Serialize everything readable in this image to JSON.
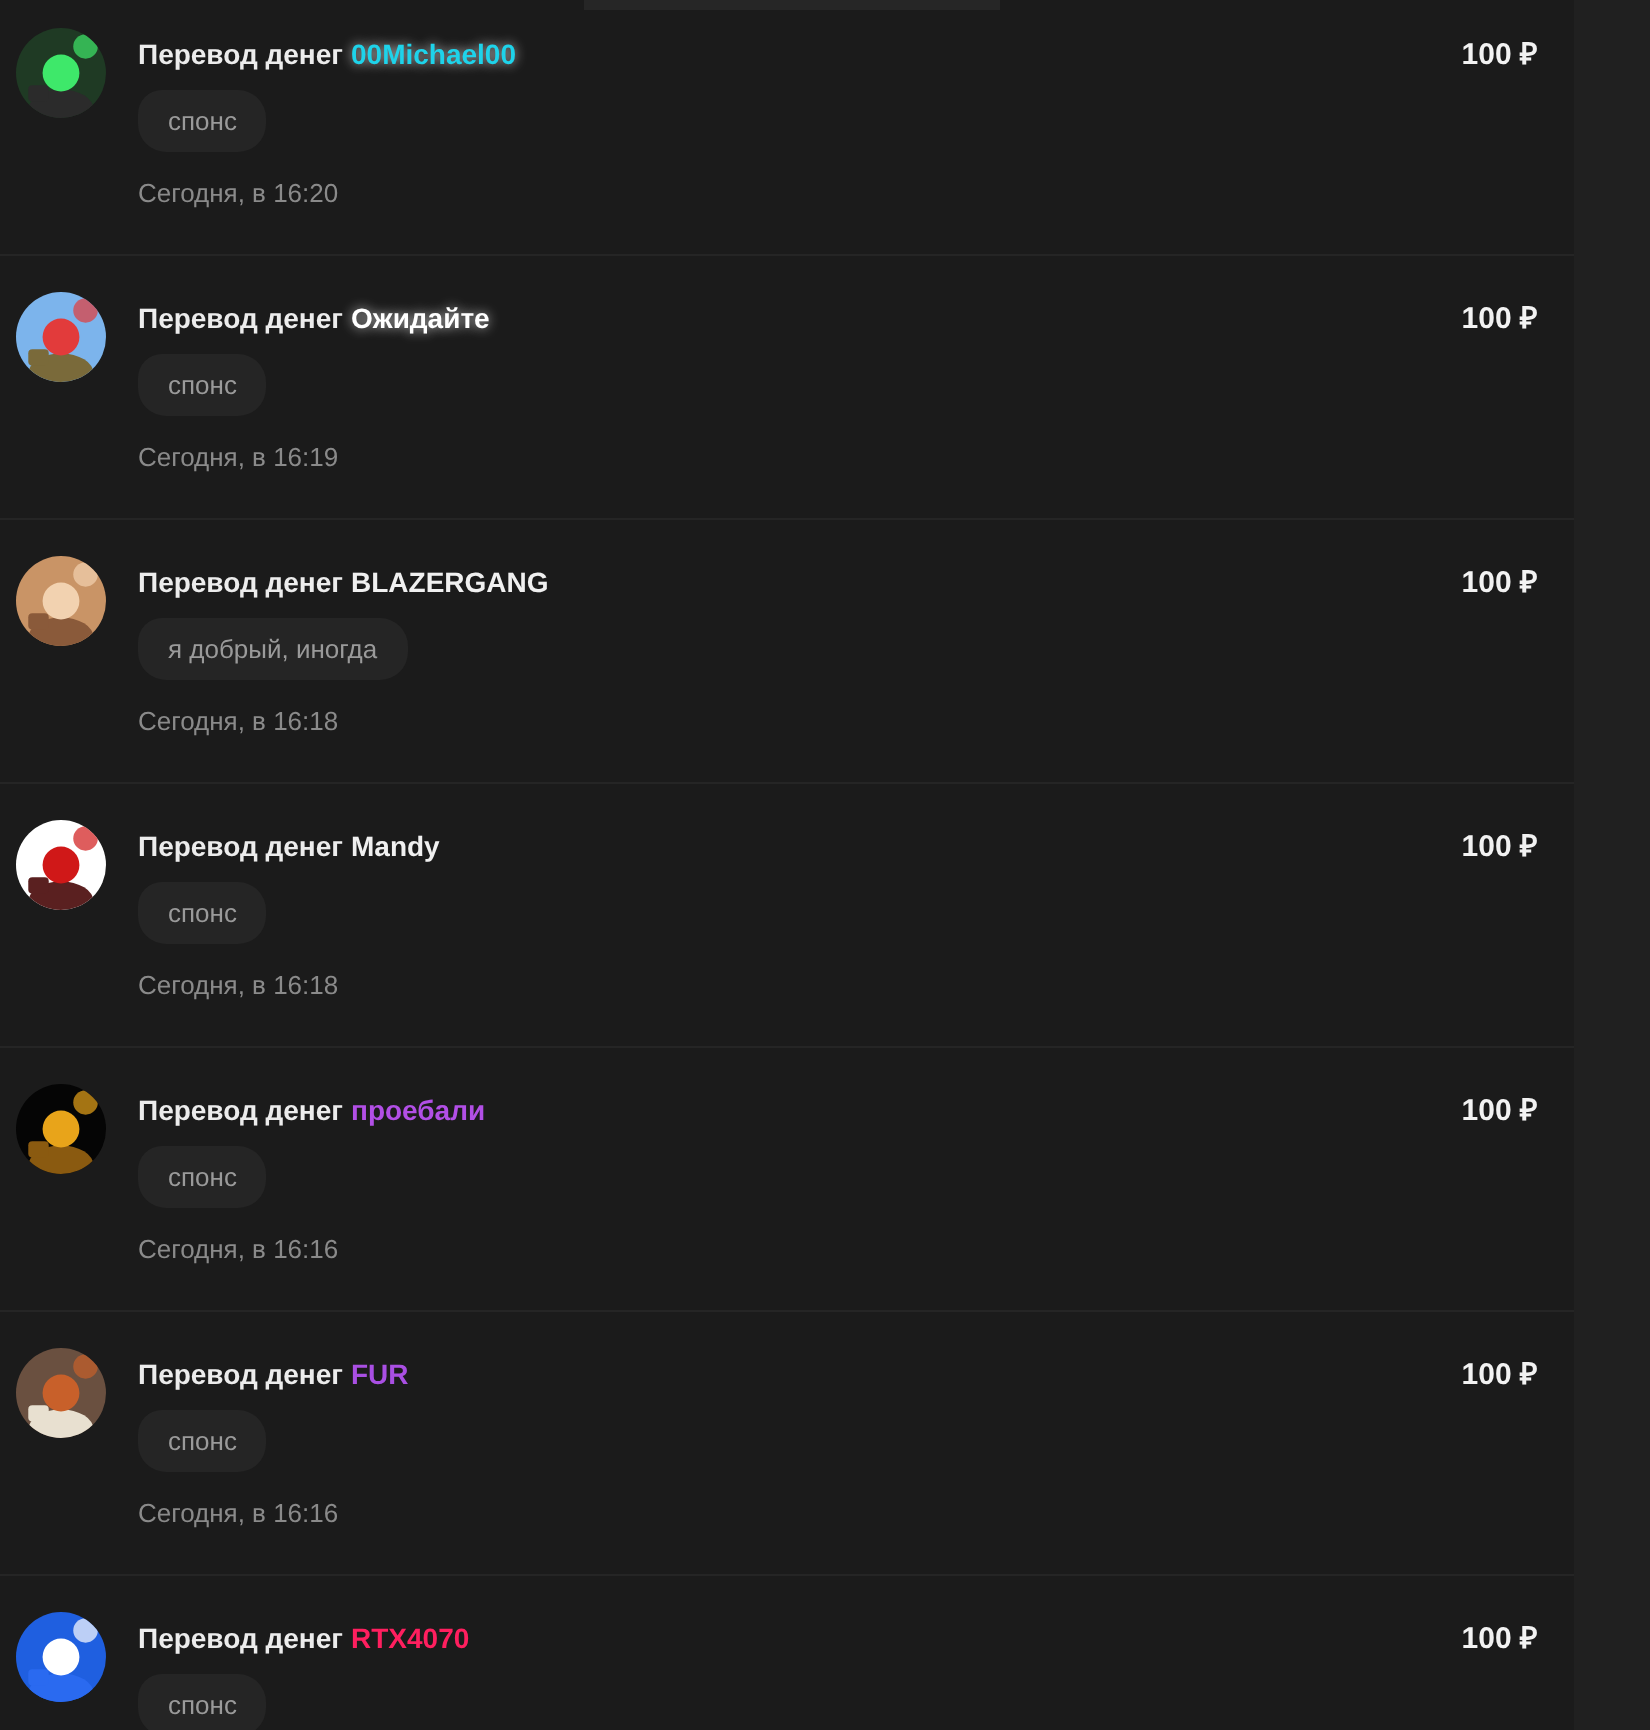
{
  "donations": [
    {
      "title": "Перевод денег",
      "sender": "00Michael00",
      "color": "#1ed3ea",
      "glow": true,
      "amount": "100 ₽",
      "message": "спонс",
      "time": "Сегодня, в 16:20"
    },
    {
      "title": "Перевод денег",
      "sender": "Ожидайте",
      "color": "#ffffff",
      "glow": true,
      "amount": "100 ₽",
      "message": "спонс",
      "time": "Сегодня, в 16:19"
    },
    {
      "title": "Перевод денег",
      "sender": "BLAZERGANG",
      "color": "#f0f0f0",
      "glow": false,
      "amount": "100 ₽",
      "message": "я добрый, иногда",
      "time": "Сегодня, в 16:18"
    },
    {
      "title": "Перевод денег",
      "sender": "Mandy",
      "color": "#f0f0f0",
      "glow": false,
      "amount": "100 ₽",
      "message": "спонс",
      "time": "Сегодня, в 16:18"
    },
    {
      "title": "Перевод денег",
      "sender": "проебали",
      "color": "#b24fe6",
      "glow": false,
      "amount": "100 ₽",
      "message": "спонс",
      "time": "Сегодня, в 16:16"
    },
    {
      "title": "Перевод денег",
      "sender": "FUR",
      "color": "#a94fe3",
      "glow": false,
      "amount": "100 ₽",
      "message": "спонс",
      "time": "Сегодня, в 16:16"
    },
    {
      "title": "Перевод денег",
      "sender": "RTX4070",
      "color": "#ff1f5f",
      "glow": false,
      "amount": "100 ₽",
      "message": "спонс"
    }
  ]
}
